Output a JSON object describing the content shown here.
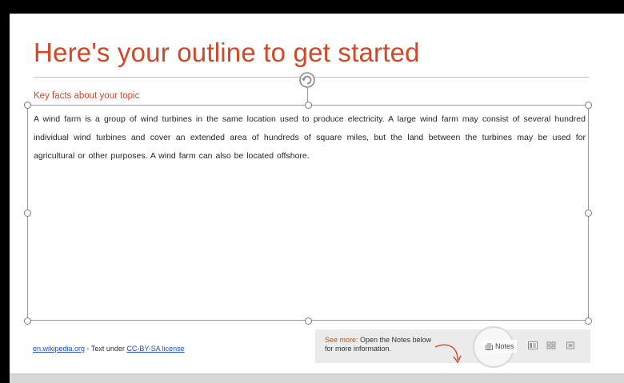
{
  "slide": {
    "title": "Here's your outline to get started",
    "subtitle": "Key facts about your topic",
    "body": "A wind farm is a group of wind turbines in the same location used to produce electricity. A large wind farm may consist of several hundred individual wind turbines and cover an extended area of hundreds of square miles, but the land between the turbines may be used for agricultural or other purposes. A wind farm can also be located offshore.",
    "accent_color": "#d24726"
  },
  "footer": {
    "source_link": "en.wikipedia.org",
    "middle_text": " - Text under ",
    "license_link": "CC-BY-SA license"
  },
  "notes_tip": {
    "see_more": "See more:",
    "message": " Open the Notes below for more information.",
    "notes_label": "Notes"
  },
  "icons": {
    "rotate": "rotate-icon",
    "notes": "notes-icon",
    "normal_view": "normal-view-icon",
    "slide_sorter": "slide-sorter-icon",
    "reading_view": "reading-view-icon"
  }
}
